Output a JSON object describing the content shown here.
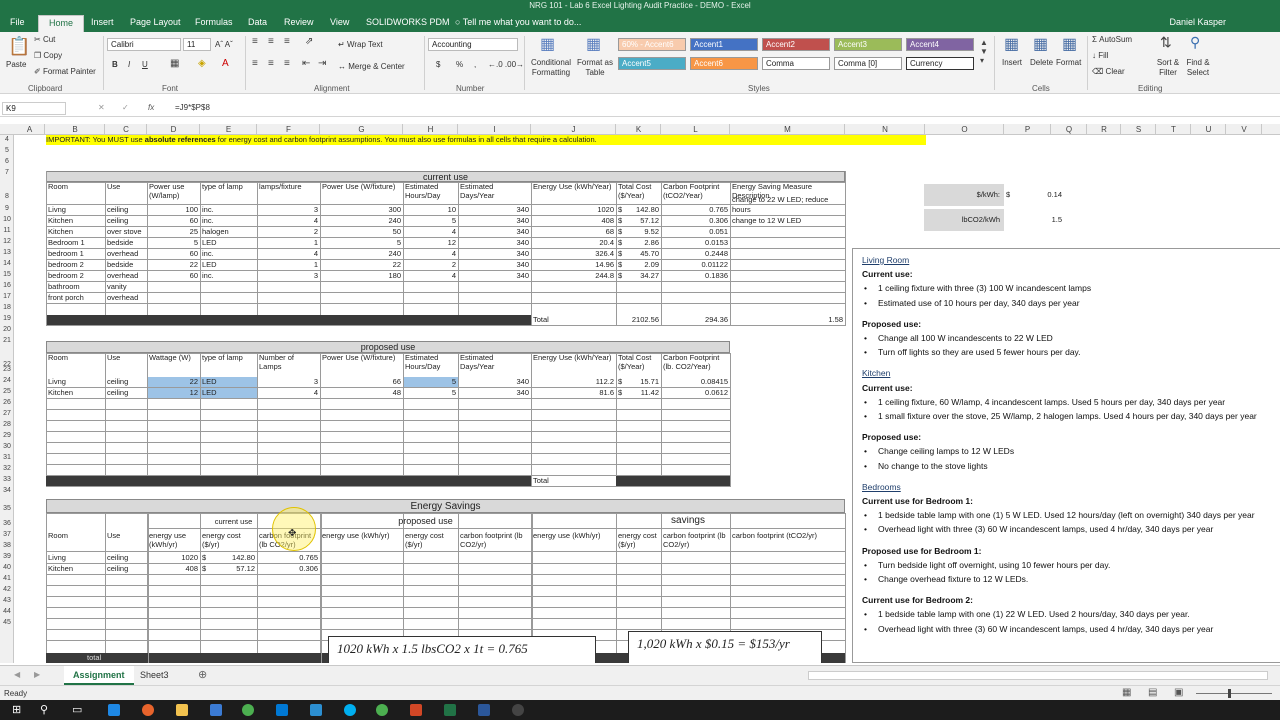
{
  "window": {
    "title": "NRG 101 - Lab 6 Excel Lighting Audit Practice - DEMO - Excel",
    "user": "Daniel Kasper"
  },
  "menu_tabs": [
    "File",
    "Home",
    "Insert",
    "Page Layout",
    "Formulas",
    "Data",
    "Review",
    "View",
    "SOLIDWORKS PDM"
  ],
  "tell_me": "Tell me what you want to do...",
  "ribbon": {
    "clipboard": {
      "paste": "Paste",
      "cut": "Cut",
      "copy": "Copy",
      "format_painter": "Format Painter",
      "label": "Clipboard"
    },
    "font": {
      "name": "Calibri",
      "size": "11",
      "label": "Font",
      "bold": "B",
      "italic": "I",
      "underline": "U"
    },
    "alignment": {
      "wrap": "Wrap Text",
      "merge": "Merge & Center",
      "label": "Alignment"
    },
    "number": {
      "format": "Accounting",
      "label": "Number",
      "currency": "$",
      "percent": "%",
      "comma": ","
    },
    "styles": {
      "cond": "Conditional Formatting",
      "table": "Format as Table",
      "label": "Styles",
      "cells": [
        {
          "text": "60% - Accent6",
          "bg": "#f8cbad",
          "fg": "#ffffff"
        },
        {
          "text": "Accent1",
          "bg": "#4472c4",
          "fg": "#ffffff"
        },
        {
          "text": "Accent2",
          "bg": "#c0504d",
          "fg": "#ffffff"
        },
        {
          "text": "Accent3",
          "bg": "#9bbb59",
          "fg": "#ffffff"
        },
        {
          "text": "Accent4",
          "bg": "#8064a2",
          "fg": "#ffffff"
        },
        {
          "text": "Accent5",
          "bg": "#4bacc6",
          "fg": "#ffffff"
        },
        {
          "text": "Accent6",
          "bg": "#f79646",
          "fg": "#ffffff"
        },
        {
          "text": "Comma",
          "bg": "#ffffff",
          "fg": "#222222"
        },
        {
          "text": "Comma [0]",
          "bg": "#ffffff",
          "fg": "#222222"
        },
        {
          "text": "Currency",
          "bg": "#ffffff",
          "fg": "#222222"
        }
      ]
    },
    "cells": {
      "insert": "Insert",
      "delete": "Delete",
      "format": "Format",
      "label": "Cells"
    },
    "editing": {
      "autosum": "AutoSum",
      "fill": "Fill",
      "clear": "Clear",
      "sort": "Sort & Filter",
      "find": "Find & Select",
      "label": "Editing"
    }
  },
  "formula_bar": {
    "name_box": "K9",
    "fx": "fx",
    "formula": "=J9*$P$8"
  },
  "columns": [
    "A",
    "B",
    "C",
    "D",
    "E",
    "F",
    "G",
    "H",
    "I",
    "J",
    "K",
    "L",
    "M",
    "N",
    "O",
    "P",
    "Q",
    "R",
    "S",
    "T",
    "U",
    "V"
  ],
  "rows": [
    "4",
    "5",
    "6",
    "7",
    "8",
    "9",
    "10",
    "11",
    "12",
    "13",
    "14",
    "15",
    "16",
    "17",
    "18",
    "19",
    "20",
    "21",
    "22",
    "23",
    "24",
    "25",
    "26",
    "27",
    "28",
    "29",
    "30",
    "31",
    "32",
    "33",
    "34",
    "35",
    "36",
    "37",
    "38",
    "39",
    "40",
    "41",
    "42",
    "43",
    "44",
    "45"
  ],
  "important": {
    "pre": "IMPORTANT: You MUST use ",
    "bold": "absolute references",
    "post": " for energy cost and carbon footprint assumptions.  You must also use formulas in all cells that require a calculation."
  },
  "assumptions": {
    "cost_label": "$/kWh:",
    "cost_cur": "$",
    "cost_val": "0.14",
    "co2_label": "lbCO2/kWh",
    "co2_val": "1.5"
  },
  "current": {
    "title": "current use",
    "headers": [
      "Room",
      "Use",
      "Power use (W/lamp)",
      "type of lamp",
      "lamps/fixture",
      "Power Use (W/fixture)",
      "Estimated Hours/Day",
      "Estimated Days/Year",
      "Energy Use (kWh/Year)",
      "Total Cost ($/Year)",
      "Carbon Footprint (tCO2/Year)",
      "Energy Saving Measure Description"
    ],
    "rows": [
      [
        "Livng",
        "ceiling",
        "100",
        "inc.",
        "3",
        "300",
        "10",
        "340",
        "1020",
        "142.80",
        "0.765",
        "change to 22 W LED; reduce hours"
      ],
      [
        "Kitchen",
        "ceiling",
        "60",
        "inc.",
        "4",
        "240",
        "5",
        "340",
        "408",
        "57.12",
        "0.306",
        "change to 12 W LED"
      ],
      [
        "Kitchen",
        "over stove",
        "25",
        "halogen",
        "2",
        "50",
        "4",
        "340",
        "68",
        "9.52",
        "0.051",
        ""
      ],
      [
        "Bedroom 1",
        "bedside",
        "5",
        "LED",
        "1",
        "5",
        "12",
        "340",
        "20.4",
        "2.86",
        "0.0153",
        ""
      ],
      [
        "bedroom 1",
        "overhead",
        "60",
        "inc.",
        "4",
        "240",
        "4",
        "340",
        "326.4",
        "45.70",
        "0.2448",
        ""
      ],
      [
        "bedroom 2",
        "bedside",
        "22",
        "LED",
        "1",
        "22",
        "2",
        "340",
        "14.96",
        "2.09",
        "0.01122",
        ""
      ],
      [
        "bedroom 2",
        "overhead",
        "60",
        "inc.",
        "3",
        "180",
        "4",
        "340",
        "244.8",
        "34.27",
        "0.1836",
        ""
      ],
      [
        "bathroom",
        "vanity",
        "",
        "",
        "",
        "",
        "",
        "",
        "",
        "",
        "",
        ""
      ],
      [
        "front porch",
        "overhead",
        "",
        "",
        "",
        "",
        "",
        "",
        "",
        "",
        "",
        ""
      ]
    ],
    "total_label": "Total",
    "total_energy": "2102.56",
    "total_cost": "294.36",
    "total_co2": "1.58"
  },
  "proposed": {
    "title": "proposed use",
    "headers": [
      "Room",
      "Use",
      "Wattage (W)",
      "type of lamp",
      "Number of Lamps",
      "Power Use (W/fixture)",
      "Estimated Hours/Day",
      "Estimated Days/Year",
      "Energy Use (kWh/Year)",
      "Total Cost ($/Year)",
      "Carbon Footprint (lb. CO2/Year)"
    ],
    "rows": [
      [
        "Livng",
        "ceiling",
        "22",
        "LED",
        "3",
        "66",
        "5",
        "340",
        "112.2",
        "15.71",
        "0.08415"
      ],
      [
        "Kitchen",
        "ceiling",
        "12",
        "LED",
        "4",
        "48",
        "5",
        "340",
        "81.6",
        "11.42",
        "0.0612"
      ]
    ],
    "total_label": "Total"
  },
  "savings": {
    "title": "Energy Savings",
    "sub_current": "current use",
    "sub_proposed": "proposed use",
    "sub_savings": "savings",
    "headers": [
      "Room",
      "Use",
      "energy use (kWh/yr)",
      "energy cost ($/yr)",
      "carbon footprint (lb CO2/yr)",
      "energy use (kWh/yr)",
      "energy cost ($/yr)",
      "carbon footprint (lb CO2/yr)",
      "energy use (kWh/yr)",
      "energy cost ($/yr)",
      "carbon footprint (lb CO2/yr)",
      "carbon footprint (tCO2/yr)"
    ],
    "rows": [
      [
        "Livng",
        "ceiling",
        "1020",
        "142.80",
        "0.765"
      ],
      [
        "Kitchen",
        "ceiling",
        "408",
        "57.12",
        "0.306"
      ]
    ],
    "total_label": "total"
  },
  "notes": [
    {
      "t": "Living Room",
      "k": "u"
    },
    {
      "t": "Current use:",
      "k": "b"
    },
    {
      "t": "1 ceiling fixture with three (3) 100 W incandescent lamps",
      "k": "bl"
    },
    {
      "t": "Estimated use of 10 hours per day, 340 days per year",
      "k": "bl"
    },
    {
      "t": "",
      "k": "gap"
    },
    {
      "t": "Proposed use:",
      "k": "b"
    },
    {
      "t": "Change all 100 W incandescents to 22 W LED",
      "k": "bl"
    },
    {
      "t": "Turn off lights so they are used 5 fewer hours per day.",
      "k": "bl"
    },
    {
      "t": "",
      "k": "gap"
    },
    {
      "t": "Kitchen",
      "k": "u"
    },
    {
      "t": "Current use:",
      "k": "b"
    },
    {
      "t": "1 ceiling fixture, 60 W/lamp, 4 incandescent lamps.  Used 5 hours per day, 340 days per year",
      "k": "bl"
    },
    {
      "t": "1 small fixture over the stove, 25 W/lamp, 2 halogen lamps. Used 4 hours per day, 340 days per year",
      "k": "bl"
    },
    {
      "t": "",
      "k": "gap"
    },
    {
      "t": "Proposed use:",
      "k": "b"
    },
    {
      "t": "Change ceiling lamps to 12 W LEDs",
      "k": "bl"
    },
    {
      "t": "No change to the stove lights",
      "k": "bl"
    },
    {
      "t": "",
      "k": "gap"
    },
    {
      "t": "Bedrooms",
      "k": "u"
    },
    {
      "t": "Current use for Bedroom 1:",
      "k": "b"
    },
    {
      "t": "1 bedside table lamp with one (1) 5 W LED.  Used 12 hours/day (left on overnight) 340 days per year",
      "k": "bl"
    },
    {
      "t": "Overhead light with three (3) 60 W incandescent lamps, used 4 hr/day, 340 days per year",
      "k": "bl"
    },
    {
      "t": "",
      "k": "gap"
    },
    {
      "t": "Proposed use for Bedroom 1:",
      "k": "b"
    },
    {
      "t": "Turn bedside light off overnight, using 10 fewer hours per day.",
      "k": "bl"
    },
    {
      "t": "Change overhead fixture to 12 W LEDs.",
      "k": "bl"
    },
    {
      "t": "",
      "k": "gap"
    },
    {
      "t": "Current use for Bedroom 2:",
      "k": "b"
    },
    {
      "t": "1 bedside table lamp with one (1) 22 W LED.  Used 2 hours/day, 340 days per year.",
      "k": "bl"
    },
    {
      "t": "Overhead light with three (3) 60 W incandescent lamps, used 4 hr/day, 340 days per year",
      "k": "bl"
    }
  ],
  "eq1": "1020 kWh x 1.5 lbsCO2 x 1t = 0.765",
  "eq2": "1,020 kWh x $0.15 = $153/yr",
  "sheet_tabs": [
    "Assignment",
    "Sheet3"
  ],
  "status": "Ready"
}
